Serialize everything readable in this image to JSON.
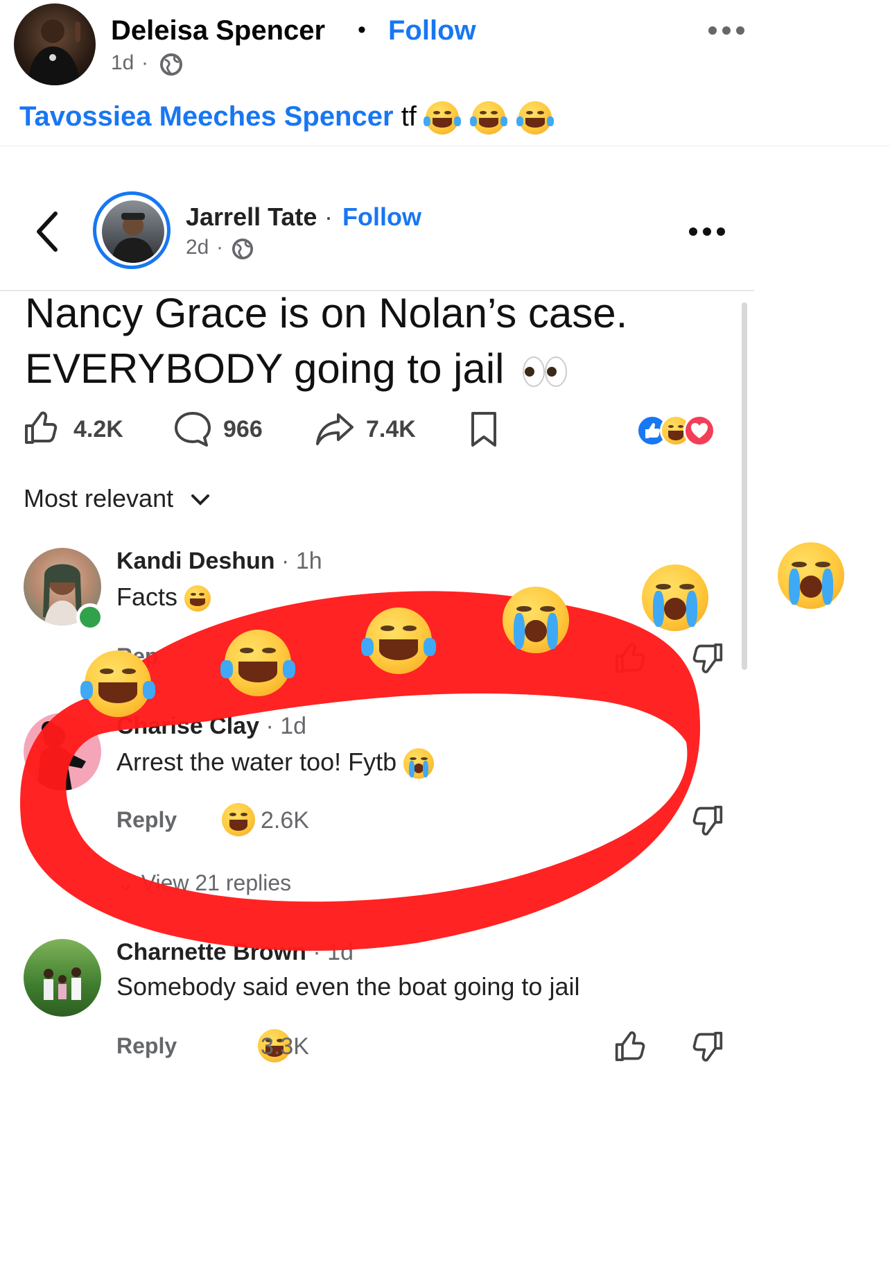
{
  "outer_post": {
    "author": "Deleisa Spencer",
    "follow_label": "Follow",
    "dot": "•",
    "time": "1d",
    "caption_mention": "Tavossiea Meeches Spencer",
    "caption_text": "tf",
    "caption_emojis": [
      "laughing-tears",
      "laughing-tears",
      "laughing-tears"
    ],
    "more_icon": "more-horizontal-icon",
    "privacy_icon": "globe-icon"
  },
  "shared_post": {
    "author": "Jarrell Tate",
    "separator": "·",
    "follow_label": "Follow",
    "time": "2d",
    "text_line1": "Nancy Grace is on Nolan’s case.",
    "text_line2": "EVERYBODY going to jail",
    "stats": {
      "likes": "4.2K",
      "comments": "966",
      "shares": "7.4K"
    },
    "reactions": [
      "like",
      "haha",
      "love"
    ],
    "sort_label": "Most relevant",
    "colors": {
      "accent": "#1877f2",
      "annotation": "#ff1a1a"
    }
  },
  "comments": [
    {
      "name": "Kandi Deshun",
      "time": "1h",
      "text": "Facts",
      "reply_label": "Rep",
      "online": true
    },
    {
      "name": "Charise Clay",
      "time": "1d",
      "text": "Arrest the water too! Fytb",
      "reply_label": "Reply",
      "reaction_count": "2.6K",
      "view_replies": "View 21 replies"
    },
    {
      "name": "Charnette Brown",
      "time": "1d",
      "text": "Somebody said even the boat going to jail",
      "reply_label": "Reply",
      "reaction_count": "3.3K"
    }
  ],
  "overlay_emojis": [
    "laughing-tears",
    "laughing-tears",
    "laughing-tears",
    "crying",
    "crying",
    "crying"
  ]
}
